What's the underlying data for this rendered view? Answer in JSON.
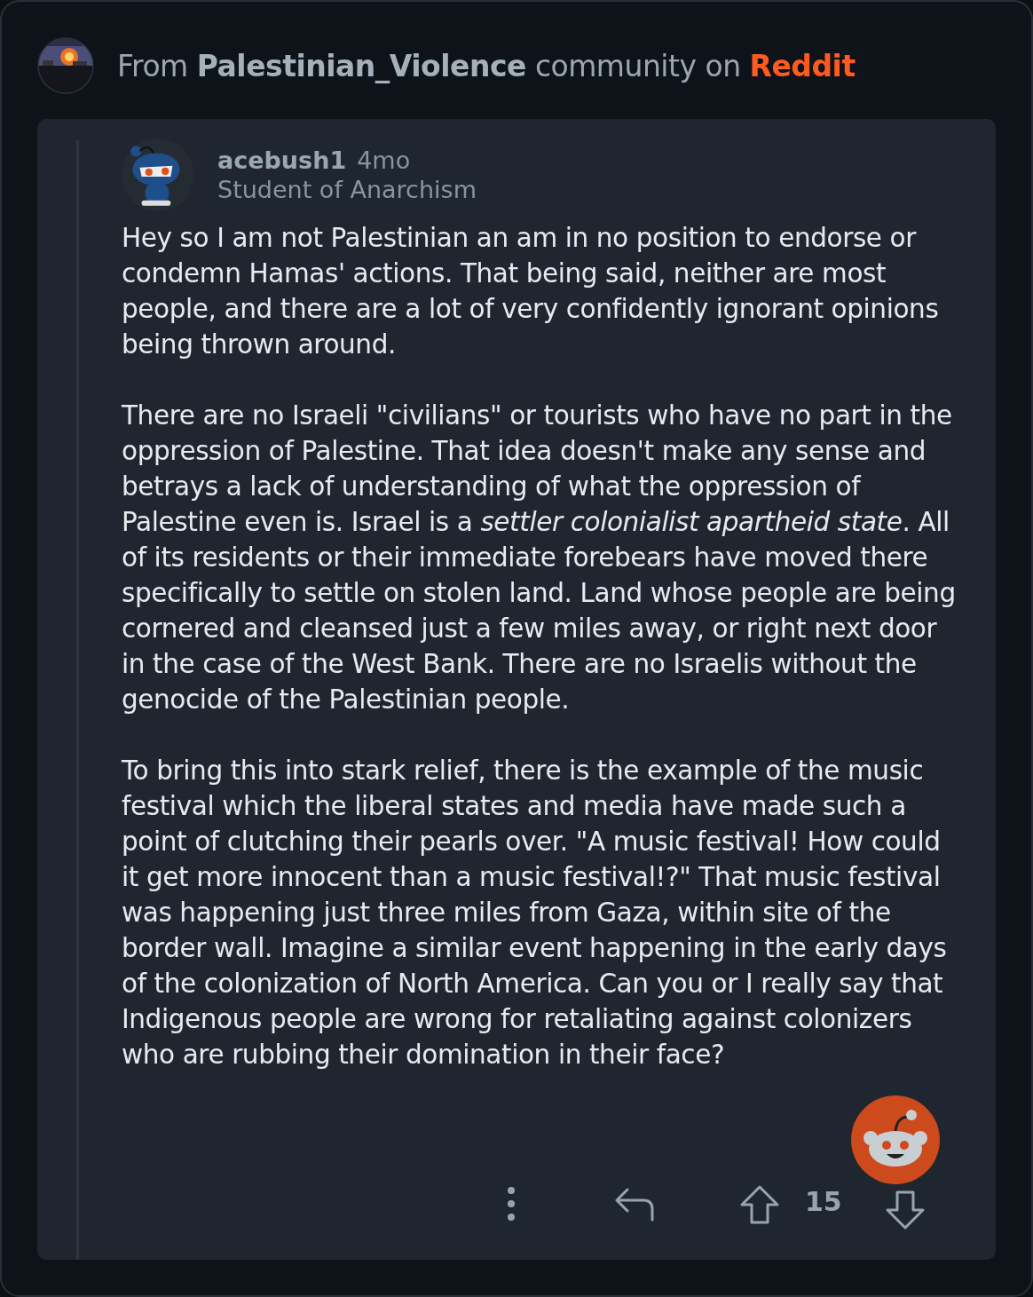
{
  "header": {
    "prefix": "From",
    "community": "Palestinian_Violence",
    "middle": "community on",
    "site": "Reddit"
  },
  "comment": {
    "username": "acebush1",
    "age": "4mo",
    "flair": "Student of Anarchism",
    "paragraphs": [
      "Hey so I am not Palestinian an am in no position to endorse or condemn Hamas' actions. That being said, neither are most people, and there are a lot of very confidently ignorant opinions being thrown around.",
      "There are no Israeli \"civilians\" or tourists who have no part in the oppression of Palestine. That idea doesn't make any sense and betrays a lack of understanding of what the oppression of Palestine even is. Israel is a *settler colonialist apartheid state*. All of its residents or their immediate forebears have moved there specifically to settle on stolen land. Land whose people are being cornered and cleansed just a few miles away, or right next door in the case of the West Bank. There are no Israelis without the genocide of the Palestinian people.",
      "To bring this into stark relief, there is the example of the music festival which the liberal states and media have made such a point of clutching their pearls over. \"A music festival! How could it get more innocent than a music festival!?\" That music festival was happening just three miles from Gaza, within site of the border wall. Imagine a similar event happening in the early days of the colonization of North America. Can you or I really say that Indigenous people are wrong for retaliating against colonizers who are rubbing their domination in their face?"
    ],
    "score": "15"
  }
}
